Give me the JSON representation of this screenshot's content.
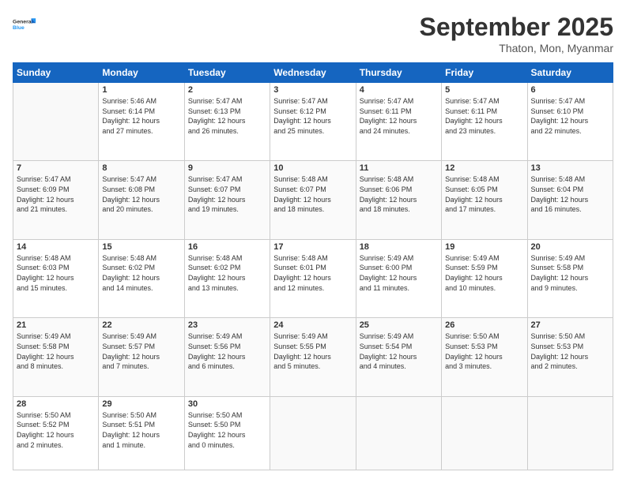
{
  "header": {
    "logo_line1": "General",
    "logo_line2": "Blue",
    "month": "September 2025",
    "location": "Thaton, Mon, Myanmar"
  },
  "days_of_week": [
    "Sunday",
    "Monday",
    "Tuesday",
    "Wednesday",
    "Thursday",
    "Friday",
    "Saturday"
  ],
  "weeks": [
    [
      {
        "day": "",
        "info": ""
      },
      {
        "day": "1",
        "info": "Sunrise: 5:46 AM\nSunset: 6:14 PM\nDaylight: 12 hours\nand 27 minutes."
      },
      {
        "day": "2",
        "info": "Sunrise: 5:47 AM\nSunset: 6:13 PM\nDaylight: 12 hours\nand 26 minutes."
      },
      {
        "day": "3",
        "info": "Sunrise: 5:47 AM\nSunset: 6:12 PM\nDaylight: 12 hours\nand 25 minutes."
      },
      {
        "day": "4",
        "info": "Sunrise: 5:47 AM\nSunset: 6:11 PM\nDaylight: 12 hours\nand 24 minutes."
      },
      {
        "day": "5",
        "info": "Sunrise: 5:47 AM\nSunset: 6:11 PM\nDaylight: 12 hours\nand 23 minutes."
      },
      {
        "day": "6",
        "info": "Sunrise: 5:47 AM\nSunset: 6:10 PM\nDaylight: 12 hours\nand 22 minutes."
      }
    ],
    [
      {
        "day": "7",
        "info": "Sunrise: 5:47 AM\nSunset: 6:09 PM\nDaylight: 12 hours\nand 21 minutes."
      },
      {
        "day": "8",
        "info": "Sunrise: 5:47 AM\nSunset: 6:08 PM\nDaylight: 12 hours\nand 20 minutes."
      },
      {
        "day": "9",
        "info": "Sunrise: 5:47 AM\nSunset: 6:07 PM\nDaylight: 12 hours\nand 19 minutes."
      },
      {
        "day": "10",
        "info": "Sunrise: 5:48 AM\nSunset: 6:07 PM\nDaylight: 12 hours\nand 18 minutes."
      },
      {
        "day": "11",
        "info": "Sunrise: 5:48 AM\nSunset: 6:06 PM\nDaylight: 12 hours\nand 18 minutes."
      },
      {
        "day": "12",
        "info": "Sunrise: 5:48 AM\nSunset: 6:05 PM\nDaylight: 12 hours\nand 17 minutes."
      },
      {
        "day": "13",
        "info": "Sunrise: 5:48 AM\nSunset: 6:04 PM\nDaylight: 12 hours\nand 16 minutes."
      }
    ],
    [
      {
        "day": "14",
        "info": "Sunrise: 5:48 AM\nSunset: 6:03 PM\nDaylight: 12 hours\nand 15 minutes."
      },
      {
        "day": "15",
        "info": "Sunrise: 5:48 AM\nSunset: 6:02 PM\nDaylight: 12 hours\nand 14 minutes."
      },
      {
        "day": "16",
        "info": "Sunrise: 5:48 AM\nSunset: 6:02 PM\nDaylight: 12 hours\nand 13 minutes."
      },
      {
        "day": "17",
        "info": "Sunrise: 5:48 AM\nSunset: 6:01 PM\nDaylight: 12 hours\nand 12 minutes."
      },
      {
        "day": "18",
        "info": "Sunrise: 5:49 AM\nSunset: 6:00 PM\nDaylight: 12 hours\nand 11 minutes."
      },
      {
        "day": "19",
        "info": "Sunrise: 5:49 AM\nSunset: 5:59 PM\nDaylight: 12 hours\nand 10 minutes."
      },
      {
        "day": "20",
        "info": "Sunrise: 5:49 AM\nSunset: 5:58 PM\nDaylight: 12 hours\nand 9 minutes."
      }
    ],
    [
      {
        "day": "21",
        "info": "Sunrise: 5:49 AM\nSunset: 5:58 PM\nDaylight: 12 hours\nand 8 minutes."
      },
      {
        "day": "22",
        "info": "Sunrise: 5:49 AM\nSunset: 5:57 PM\nDaylight: 12 hours\nand 7 minutes."
      },
      {
        "day": "23",
        "info": "Sunrise: 5:49 AM\nSunset: 5:56 PM\nDaylight: 12 hours\nand 6 minutes."
      },
      {
        "day": "24",
        "info": "Sunrise: 5:49 AM\nSunset: 5:55 PM\nDaylight: 12 hours\nand 5 minutes."
      },
      {
        "day": "25",
        "info": "Sunrise: 5:49 AM\nSunset: 5:54 PM\nDaylight: 12 hours\nand 4 minutes."
      },
      {
        "day": "26",
        "info": "Sunrise: 5:50 AM\nSunset: 5:53 PM\nDaylight: 12 hours\nand 3 minutes."
      },
      {
        "day": "27",
        "info": "Sunrise: 5:50 AM\nSunset: 5:53 PM\nDaylight: 12 hours\nand 2 minutes."
      }
    ],
    [
      {
        "day": "28",
        "info": "Sunrise: 5:50 AM\nSunset: 5:52 PM\nDaylight: 12 hours\nand 2 minutes."
      },
      {
        "day": "29",
        "info": "Sunrise: 5:50 AM\nSunset: 5:51 PM\nDaylight: 12 hours\nand 1 minute."
      },
      {
        "day": "30",
        "info": "Sunrise: 5:50 AM\nSunset: 5:50 PM\nDaylight: 12 hours\nand 0 minutes."
      },
      {
        "day": "",
        "info": ""
      },
      {
        "day": "",
        "info": ""
      },
      {
        "day": "",
        "info": ""
      },
      {
        "day": "",
        "info": ""
      }
    ]
  ]
}
